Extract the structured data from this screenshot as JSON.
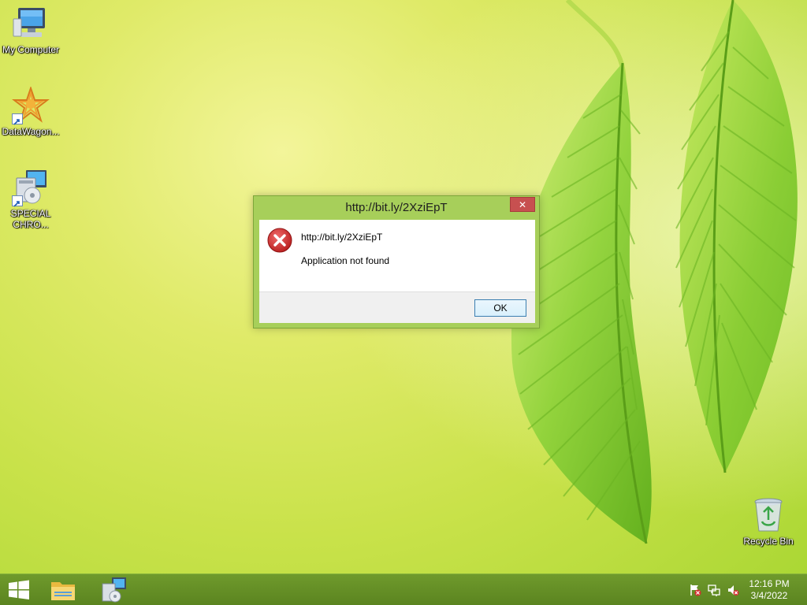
{
  "desktop": {
    "icons": [
      {
        "label": "My Computer"
      },
      {
        "label": "DataWagon..."
      },
      {
        "label": "SPECIAL\nCHRO..."
      },
      {
        "label": "Recycle Bin"
      }
    ]
  },
  "dialog": {
    "title": "http://bit.ly/2XziEpT",
    "close_label": "✕",
    "message_line1": "http://bit.ly/2XziEpT",
    "message_line2": "Application not found",
    "ok_label": "OK",
    "icon": "error-icon"
  },
  "taskbar": {
    "items": [
      {
        "icon": "windows-start-icon"
      },
      {
        "icon": "file-explorer-icon"
      },
      {
        "icon": "installer-icon"
      }
    ],
    "tray": [
      {
        "icon": "action-center-flag-icon"
      },
      {
        "icon": "network-icon"
      },
      {
        "icon": "volume-muted-icon"
      }
    ],
    "clock": {
      "time": "12:16 PM",
      "date": "3/4/2022"
    }
  },
  "colors": {
    "titlebar": "#a7cf5a",
    "close": "#c75050",
    "taskbar": "#5b8420",
    "error_red": "#d32f2f"
  }
}
